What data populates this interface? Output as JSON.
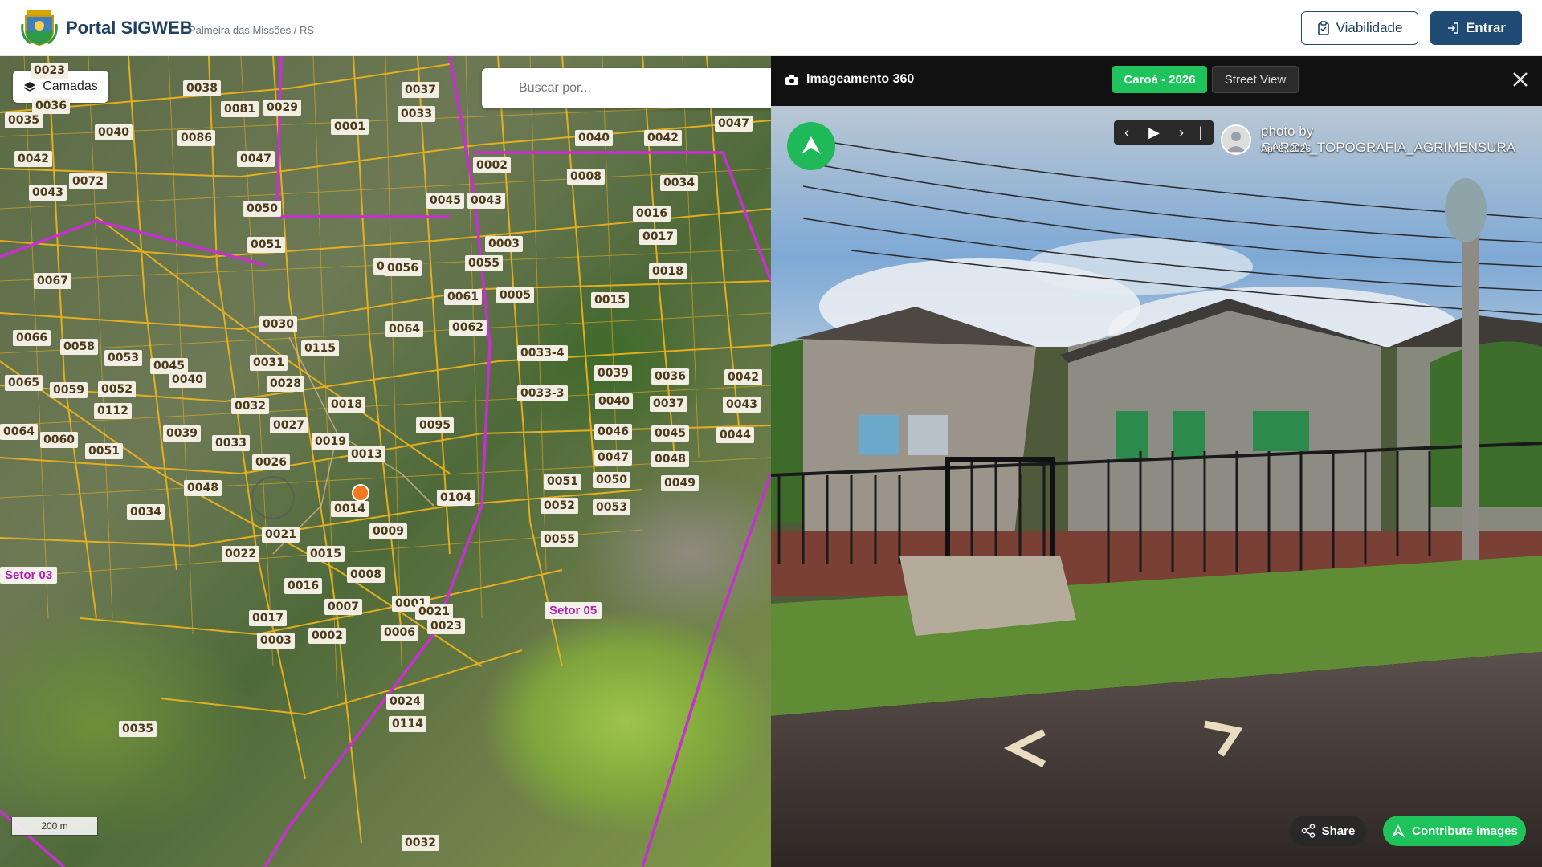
{
  "header": {
    "brand": "Portal SIGWEB",
    "subtitle": "Palmeira das Missões / RS",
    "viabilidade_label": "Viabilidade",
    "entrar_label": "Entrar"
  },
  "map": {
    "layers_label": "Camadas",
    "search_placeholder": "Buscar por...",
    "scale_label": "200 m",
    "sectors": [
      "Setor 03",
      "Setor 05"
    ],
    "parcel_labels": [
      "0023",
      "0038",
      "0036",
      "0081",
      "0029",
      "0035",
      "0040",
      "0086",
      "0042",
      "0072",
      "0047",
      "0043",
      "0050",
      "0051",
      "0067",
      "0066",
      "0058",
      "0053",
      "0045",
      "0065",
      "0059",
      "0052",
      "0112",
      "0040",
      "0032",
      "0064",
      "0060",
      "0051",
      "0039",
      "0033",
      "0026",
      "0048",
      "0034",
      "0030",
      "0031",
      "0028",
      "0027",
      "0115",
      "0018",
      "0019",
      "0013",
      "0021",
      "0022",
      "0015",
      "0014",
      "0009",
      "0016",
      "0008",
      "0007",
      "0017",
      "0006",
      "0003",
      "0002",
      "0001",
      "0021",
      "0023",
      "0024",
      "0114",
      "0035",
      "0032",
      "0037",
      "0033",
      "0001",
      "0002",
      "0043",
      "0045",
      "0055",
      "0057",
      "0056",
      "0003",
      "0061",
      "0005",
      "0064",
      "0062",
      "0095",
      "0104",
      "0040",
      "0042",
      "0047",
      "0008",
      "0034",
      "0016",
      "0017",
      "0018",
      "0015",
      "0033-4",
      "0033-3",
      "0039",
      "0036",
      "0042",
      "0040",
      "0037",
      "0043",
      "0046",
      "0045",
      "0044",
      "0047",
      "0048",
      "0049",
      "0051",
      "0050",
      "0052",
      "0053",
      "0055"
    ]
  },
  "viewer": {
    "title": "Imageamento 360",
    "tab_active": "Caroá - 2026",
    "tab_other": "Street View",
    "credit": "photo by CAROA_TOPOGRAFIA_AGRIMENSURA",
    "date": "Apr 8, 2026",
    "share_label": "Share",
    "contribute_label": "Contribute images"
  },
  "colors": {
    "brand": "#1f3f63",
    "accent_green": "#1ec35b",
    "sector_magenta": "#c62fd0",
    "parcel_lines": "#f2b51c",
    "pin": "#f47721"
  },
  "icons": [
    "coat-of-arms-logo",
    "clipboard-icon",
    "login-icon",
    "layers-icon",
    "camera-icon",
    "close-icon",
    "compass-icon",
    "chevron-left-icon",
    "play-icon",
    "chevron-right-icon",
    "share-icon",
    "contribute-icon"
  ]
}
